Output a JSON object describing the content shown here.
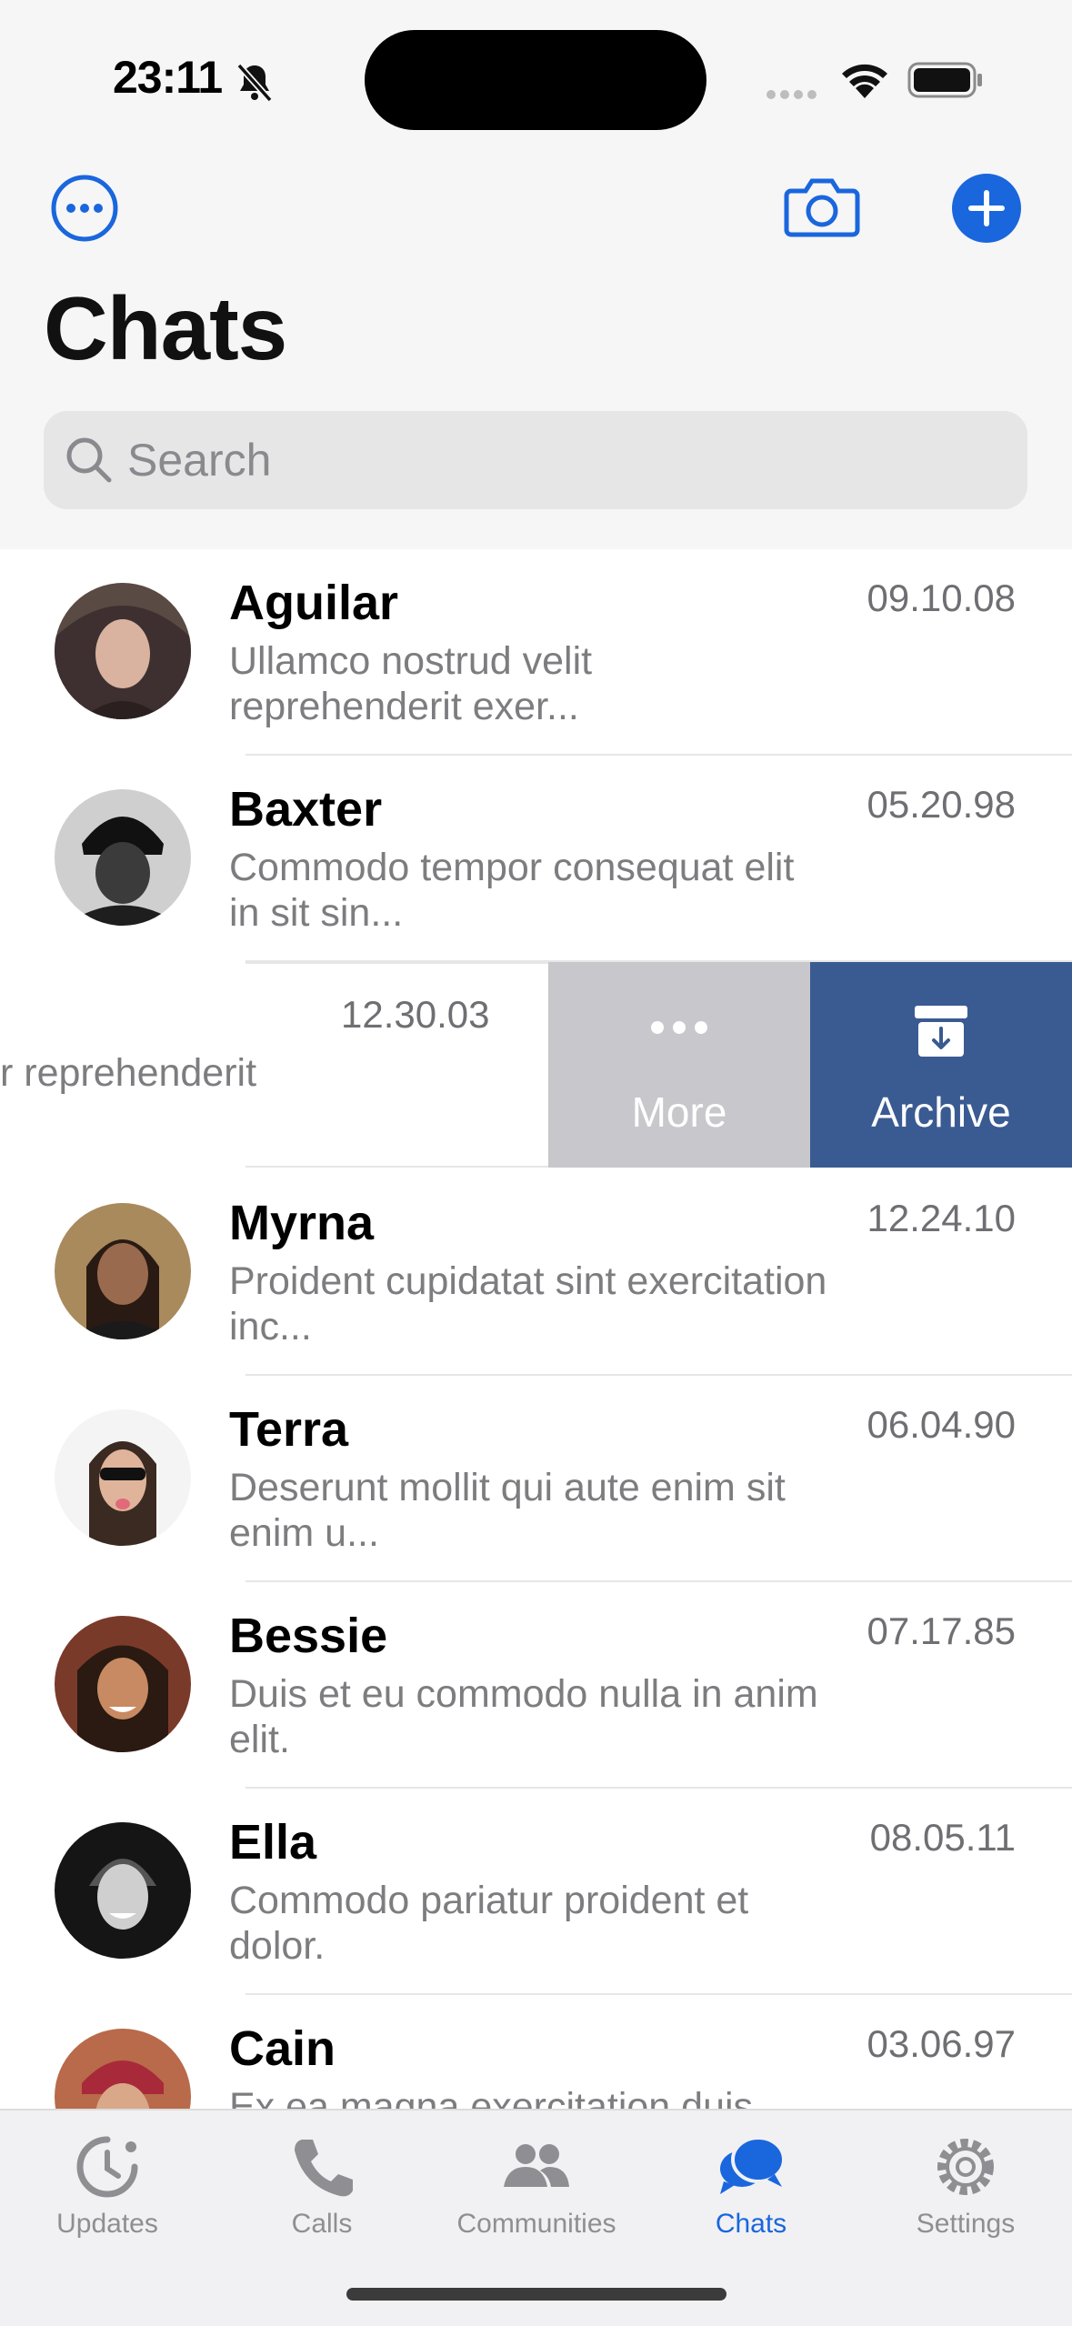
{
  "status_bar": {
    "time": "23:11"
  },
  "header": {
    "title": "Chats"
  },
  "search": {
    "placeholder": "Search"
  },
  "chats": [
    {
      "name": "Aguilar",
      "preview": "Ullamco nostrud velit reprehenderit exer...",
      "time": "09.10.08"
    },
    {
      "name": "Baxter",
      "preview": "Commodo tempor consequat elit in sit sin...",
      "time": "05.20.98"
    },
    {
      "name": "",
      "preview": "r reprehenderit",
      "time": "12.30.03"
    },
    {
      "name": "Myrna",
      "preview": "Proident cupidatat sint exercitation inc...",
      "time": "12.24.10"
    },
    {
      "name": "Terra",
      "preview": "Deserunt mollit qui aute enim sit enim u...",
      "time": "06.04.90"
    },
    {
      "name": "Bessie",
      "preview": "Duis et eu commodo nulla in anim elit.",
      "time": "07.17.85"
    },
    {
      "name": "Ella",
      "preview": "Commodo pariatur proident et dolor.",
      "time": "08.05.11"
    },
    {
      "name": "Cain",
      "preview": "Ex ea magna exercitation duis...",
      "time": "03.06.97"
    }
  ],
  "swipe_actions": {
    "more": "More",
    "archive": "Archive"
  },
  "tabs": [
    {
      "label": "Updates",
      "icon": "updates-icon"
    },
    {
      "label": "Calls",
      "icon": "phone-icon"
    },
    {
      "label": "Communities",
      "icon": "communities-icon"
    },
    {
      "label": "Chats",
      "icon": "chats-icon",
      "active": true
    },
    {
      "label": "Settings",
      "icon": "gear-icon"
    }
  ],
  "colors": {
    "accent": "#1a66dd",
    "archive": "#3a5a92",
    "more": "#c7c7cc"
  }
}
